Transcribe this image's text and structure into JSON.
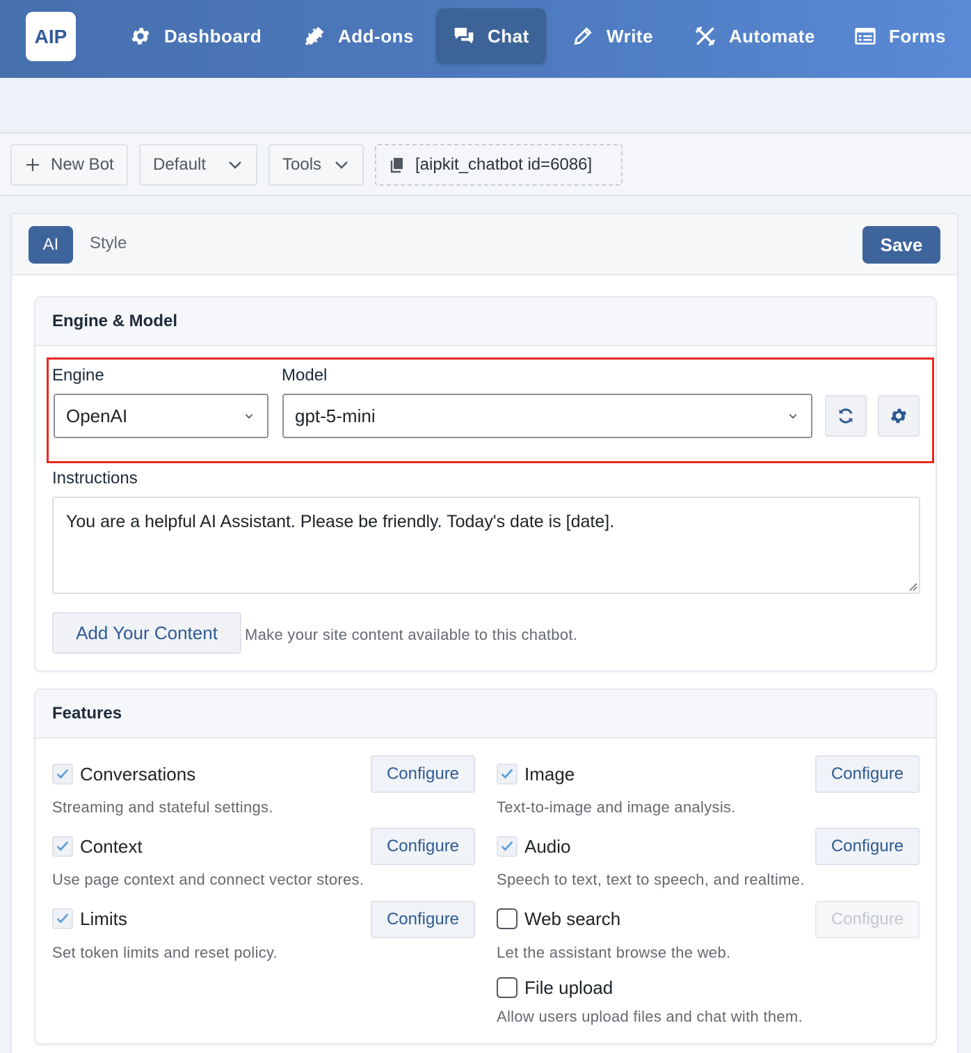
{
  "nav": {
    "logo": "AIP",
    "items": [
      {
        "label": "Dashboard",
        "icon": "gear-icon"
      },
      {
        "label": "Add-ons",
        "icon": "plug-icon"
      },
      {
        "label": "Chat",
        "icon": "chat-bubbles-icon",
        "active": true
      },
      {
        "label": "Write",
        "icon": "pencil-icon"
      },
      {
        "label": "Automate",
        "icon": "tools-icon"
      },
      {
        "label": "Forms",
        "icon": "form-icon"
      }
    ]
  },
  "toolbar": {
    "new_bot": "New Bot",
    "bot_select": "Default",
    "tools": "Tools",
    "shortcode": "[aipkit_chatbot id=6086]"
  },
  "tabs": {
    "ai": "AI",
    "style": "Style",
    "save": "Save"
  },
  "engine_model": {
    "title": "Engine & Model",
    "engine_label": "Engine",
    "engine_value": "OpenAI",
    "model_label": "Model",
    "model_value": "gpt-5-mini",
    "instructions_label": "Instructions",
    "instructions_value": "You are a helpful AI Assistant. Please be friendly. Today's date is [date].",
    "add_content": "Add Your Content",
    "add_content_help": "Make your site content available to this chatbot."
  },
  "features": {
    "title": "Features",
    "configure": "Configure",
    "items": [
      {
        "name": "Conversations",
        "desc": "Streaming and stateful settings.",
        "checked": true
      },
      {
        "name": "Image",
        "desc": "Text-to-image and image analysis.",
        "checked": true
      },
      {
        "name": "Context",
        "desc": "Use page context and connect vector stores.",
        "checked": true
      },
      {
        "name": "Audio",
        "desc": "Speech to text, text to speech, and realtime.",
        "checked": true
      },
      {
        "name": "Limits",
        "desc": "Set token limits and reset policy.",
        "checked": true
      },
      {
        "name": "Web search",
        "desc": "Let the assistant browse the web.",
        "checked": false
      },
      {
        "name": "File upload",
        "desc": "Allow users upload files and chat with them.",
        "checked": false
      }
    ]
  },
  "colors": {
    "accent": "#3e649c",
    "highlight": "#e8281c",
    "link": "#2e5a94"
  }
}
